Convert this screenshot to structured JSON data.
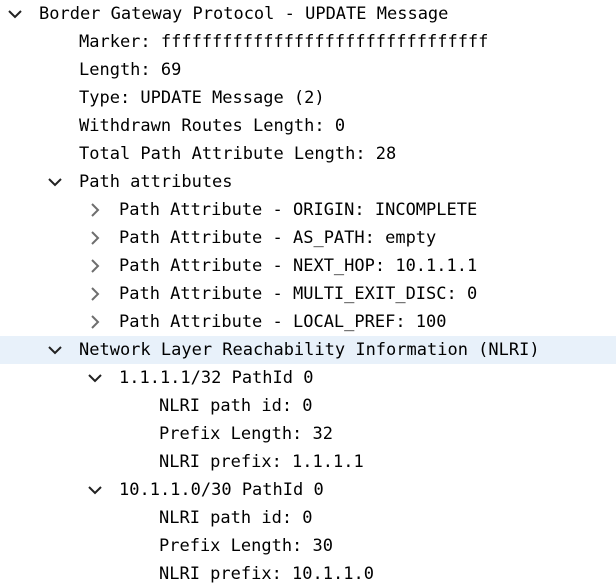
{
  "tree": {
    "bgp": {
      "label": "Border Gateway Protocol - UPDATE Message",
      "expanded": true,
      "marker": "Marker: ffffffffffffffffffffffffffffffff",
      "length": "Length: 69",
      "type": "Type: UPDATE Message (2)",
      "withdrawn_routes_length": "Withdrawn Routes Length: 0",
      "total_path_attribute_length": "Total Path Attribute Length: 28",
      "path_attributes": {
        "label": "Path attributes",
        "expanded": true,
        "items": [
          {
            "label": "Path Attribute - ORIGIN: INCOMPLETE",
            "expanded": false
          },
          {
            "label": "Path Attribute - AS_PATH: empty",
            "expanded": false
          },
          {
            "label": "Path Attribute - NEXT_HOP: 10.1.1.1",
            "expanded": false
          },
          {
            "label": "Path Attribute - MULTI_EXIT_DISC: 0",
            "expanded": false
          },
          {
            "label": "Path Attribute - LOCAL_PREF: 100",
            "expanded": false
          }
        ]
      },
      "nlri": {
        "label": "Network Layer Reachability Information (NLRI)",
        "expanded": true,
        "selected": true,
        "prefixes": [
          {
            "label": "1.1.1.1/32 PathId 0",
            "expanded": true,
            "path_id": "NLRI path id: 0",
            "prefix_length": "Prefix Length: 32",
            "prefix": "NLRI prefix: 1.1.1.1"
          },
          {
            "label": "10.1.1.0/30 PathId 0",
            "expanded": true,
            "path_id": "NLRI path id: 0",
            "prefix_length": "Prefix Length: 30",
            "prefix": "NLRI prefix: 10.1.1.0"
          }
        ]
      }
    }
  },
  "icons": {
    "expanded": "chevron-down-icon",
    "collapsed": "chevron-right-icon"
  },
  "colors": {
    "selection_background": "#e8f1fa",
    "text": "#000000",
    "chevron_expanded": "#222222",
    "chevron_collapsed": "#6e6e6e"
  }
}
